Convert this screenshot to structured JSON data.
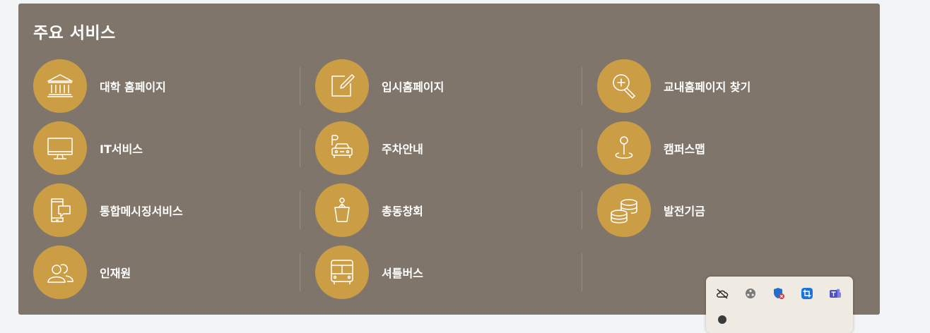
{
  "section": {
    "title": "주요 서비스"
  },
  "services": [
    {
      "label": "대학 홈페이지",
      "icon": "bank-icon"
    },
    {
      "label": "입시홈페이지",
      "icon": "edit-icon"
    },
    {
      "label": "교내홈페이지 찾기",
      "icon": "search-zoom-icon"
    },
    {
      "label": "IT서비스",
      "icon": "monitor-icon"
    },
    {
      "label": "주차안내",
      "icon": "car-icon"
    },
    {
      "label": "캠퍼스맵",
      "icon": "map-pin-icon"
    },
    {
      "label": "통합메시징서비스",
      "icon": "mobile-message-icon"
    },
    {
      "label": "총동창회",
      "icon": "podium-person-icon"
    },
    {
      "label": "발전기금",
      "icon": "coins-icon"
    },
    {
      "label": "인재원",
      "icon": "people-icon"
    },
    {
      "label": "셔틀버스",
      "icon": "bus-icon"
    }
  ],
  "tray": {
    "icons": [
      "cloud-offline-icon",
      "film-reel-icon",
      "security-shield-icon",
      "crop-tool-icon",
      "teams-icon"
    ]
  },
  "colors": {
    "panel": "#7f756a",
    "circle": "#cb9e45",
    "text": "#ffffff",
    "page": "#f3f4f6"
  }
}
